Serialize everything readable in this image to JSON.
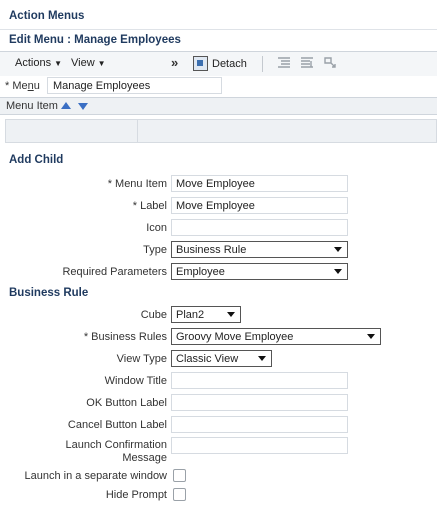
{
  "header": {
    "title": "Action Menus",
    "subtitle": "Edit Menu : Manage Employees"
  },
  "toolbar": {
    "actions_label": "Actions",
    "view_label": "View",
    "detach_label": "Detach"
  },
  "menu": {
    "label_prefix": "* Me",
    "label_underlined": "n",
    "label_suffix": "u",
    "value": "Manage Employees"
  },
  "table": {
    "column_header": "Menu Item"
  },
  "add_child": {
    "title": "Add Child",
    "menu_item_label": "* Menu Item",
    "menu_item_value": "Move Employee",
    "label_label": "* Label",
    "label_value": "Move Employee",
    "icon_label": "Icon",
    "icon_value": "",
    "type_label": "Type",
    "type_value": "Business Rule",
    "req_params_label": "Required Parameters",
    "req_params_value": "Employee"
  },
  "business_rule": {
    "title": "Business Rule",
    "cube_label": "Cube",
    "cube_value": "Plan2",
    "rules_label": "* Business Rules",
    "rules_value": "Groovy Move Employee",
    "view_type_label": "View Type",
    "view_type_value": "Classic View",
    "window_title_label": "Window Title",
    "ok_label": "OK Button Label",
    "cancel_label": "Cancel Button Label",
    "launch_conf_label_1": "Launch Confirmation",
    "launch_conf_label_2": "Message",
    "separate_window_label": "Launch in a separate window",
    "hide_prompt_label": "Hide Prompt"
  }
}
